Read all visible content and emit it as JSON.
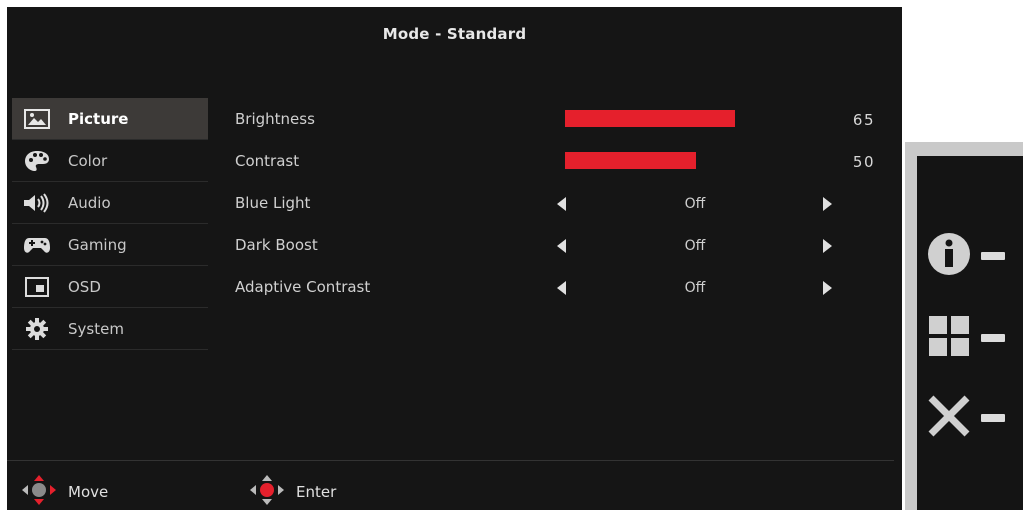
{
  "osd": {
    "title": "Mode - Standard",
    "sidebar": {
      "items": [
        {
          "label": "Picture",
          "icon": "picture-icon",
          "active": true
        },
        {
          "label": "Color",
          "icon": "palette-icon",
          "active": false
        },
        {
          "label": "Audio",
          "icon": "speaker-icon",
          "active": false
        },
        {
          "label": "Gaming",
          "icon": "gamepad-icon",
          "active": false
        },
        {
          "label": "OSD",
          "icon": "osd-window-icon",
          "active": false
        },
        {
          "label": "System",
          "icon": "gear-icon",
          "active": false
        }
      ]
    },
    "settings": {
      "brightness": {
        "label": "Brightness",
        "value": "65",
        "level": 65
      },
      "contrast": {
        "label": "Contrast",
        "value": "50",
        "level": 50
      },
      "blue_light": {
        "label": "Blue Light",
        "value": "Off"
      },
      "dark_boost": {
        "label": "Dark Boost",
        "value": "Off"
      },
      "adaptive_contrast": {
        "label": "Adaptive Contrast",
        "value": "Off"
      }
    },
    "footer": {
      "move_label": "Move",
      "enter_label": "Enter"
    },
    "colors": {
      "accent": "#e5202c",
      "background": "#151515"
    }
  },
  "hotkeys": {
    "items": [
      {
        "icon": "info-icon"
      },
      {
        "icon": "grid-menu-icon"
      },
      {
        "icon": "close-icon"
      }
    ]
  }
}
